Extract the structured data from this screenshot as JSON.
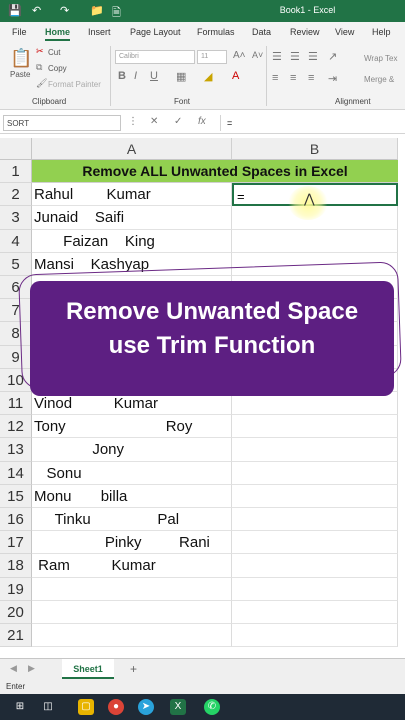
{
  "window": {
    "title": "Book1  -  Excel"
  },
  "menu": [
    "File",
    "Home",
    "Insert",
    "Page Layout",
    "Formulas",
    "Data",
    "Review",
    "View",
    "Help"
  ],
  "ribbon": {
    "paste": "Paste",
    "cut": "Cut",
    "copy": "Copy",
    "format_painter": "Format Painter",
    "font_name": "Calibri",
    "font_size": "11",
    "bold": "B",
    "italic": "I",
    "underline": "U",
    "wrap_text": "Wrap Tex",
    "merge": "Merge &",
    "groups": {
      "clipboard": "Clipboard",
      "font": "Font",
      "alignment": "Alignment"
    }
  },
  "formula_bar": {
    "name_box": "SORT",
    "fx": "fx",
    "value": "="
  },
  "columns": [
    "A",
    "B"
  ],
  "sheet": {
    "header": "Remove ALL Unwanted Spaces in Excel",
    "rows": [
      {
        "n": "1",
        "a": ""
      },
      {
        "n": "2",
        "a": "Rahul        Kumar",
        "b": "="
      },
      {
        "n": "3",
        "a": "Junaid    Saifi"
      },
      {
        "n": "4",
        "a": "       Faizan    King"
      },
      {
        "n": "5",
        "a": "Mansi    Kashyap"
      },
      {
        "n": "6",
        "a": ""
      },
      {
        "n": "7",
        "a": ""
      },
      {
        "n": "8",
        "a": ""
      },
      {
        "n": "9",
        "a": ""
      },
      {
        "n": "10",
        "a": ""
      },
      {
        "n": "11",
        "a": "Vinod          Kumar"
      },
      {
        "n": "12",
        "a": "Tony                        Roy"
      },
      {
        "n": "13",
        "a": "              Jony"
      },
      {
        "n": "14",
        "a": "   Sonu"
      },
      {
        "n": "15",
        "a": "Monu       billa"
      },
      {
        "n": "16",
        "a": "     Tinku                Pal"
      },
      {
        "n": "17",
        "a": "                 Pinky         Rani"
      },
      {
        "n": "18",
        "a": " Ram          Kumar"
      },
      {
        "n": "19",
        "a": ""
      },
      {
        "n": "20",
        "a": ""
      },
      {
        "n": "21",
        "a": ""
      }
    ]
  },
  "banner": {
    "line1": "Remove Unwanted Space",
    "line2": "use Trim Function"
  },
  "tabs": {
    "sheet": "Sheet1",
    "add": "+"
  },
  "status": {
    "mode": "Enter"
  },
  "colors": {
    "excel_green": "#217346",
    "header_fill": "#92d050",
    "banner": "#5d1f82"
  }
}
